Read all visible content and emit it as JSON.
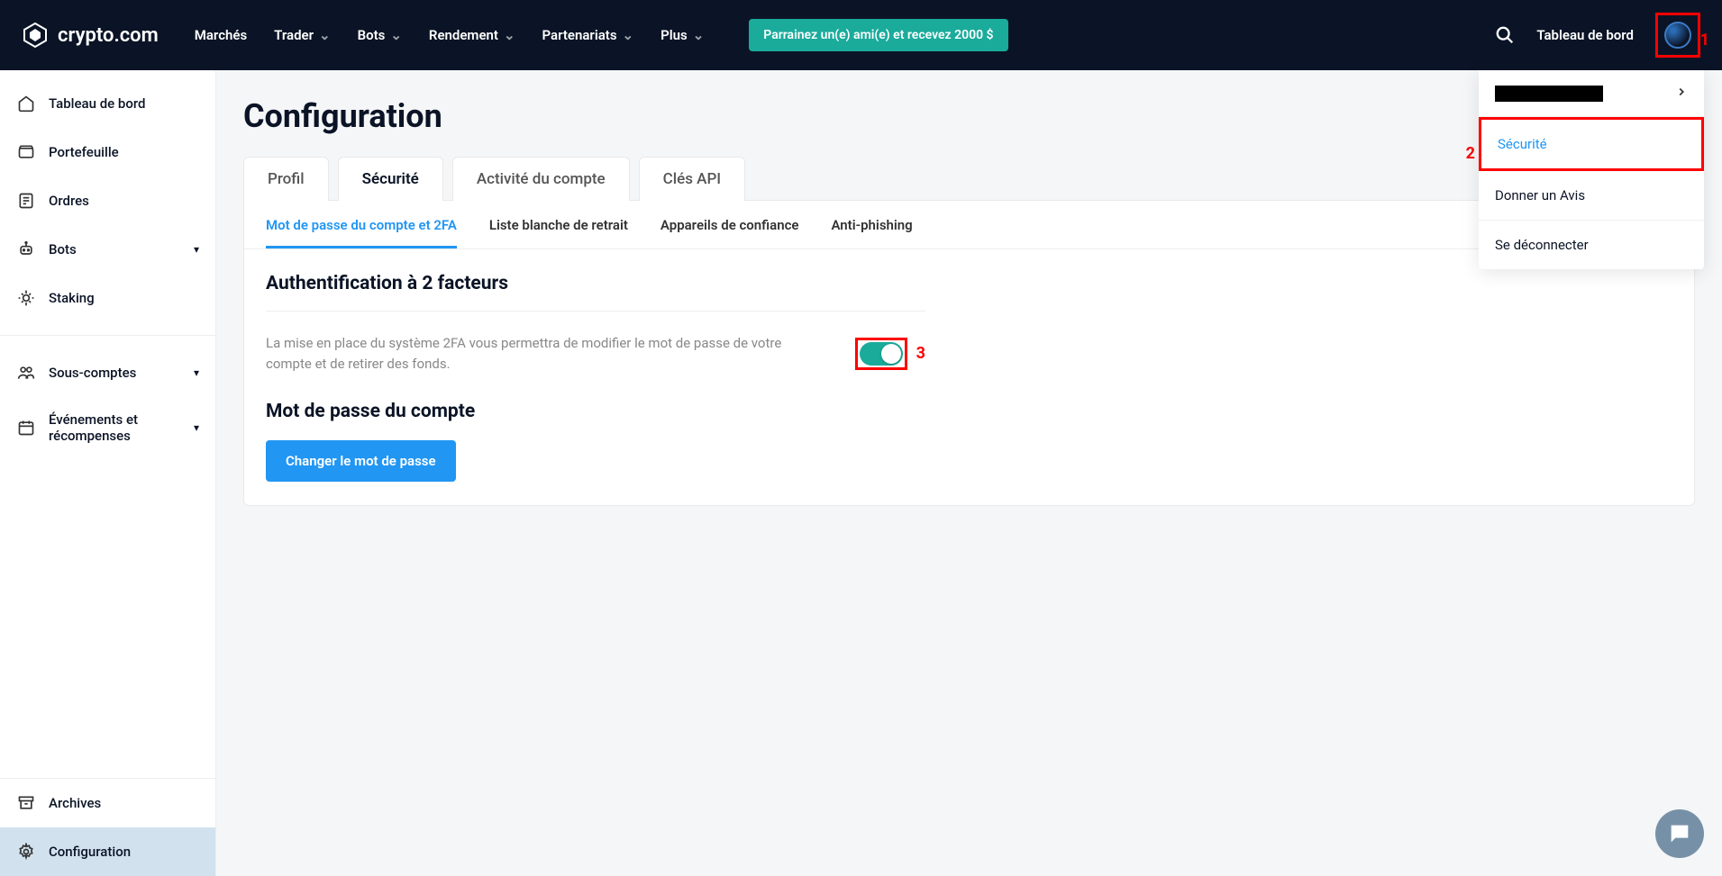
{
  "brand": "crypto.com",
  "nav": {
    "items": [
      {
        "label": "Marchés",
        "dropdown": false
      },
      {
        "label": "Trader",
        "dropdown": true
      },
      {
        "label": "Bots",
        "dropdown": true
      },
      {
        "label": "Rendement",
        "dropdown": true
      },
      {
        "label": "Partenariats",
        "dropdown": true
      },
      {
        "label": "Plus",
        "dropdown": true
      }
    ],
    "promo": "Parrainez un(e) ami(e) et recevez 2000 $",
    "dashboard": "Tableau de bord"
  },
  "sidebar": {
    "main": [
      {
        "label": "Tableau de bord",
        "icon": "home"
      },
      {
        "label": "Portefeuille",
        "icon": "wallet"
      },
      {
        "label": "Ordres",
        "icon": "orders"
      },
      {
        "label": "Bots",
        "icon": "bot",
        "expand": true
      },
      {
        "label": "Staking",
        "icon": "staking"
      }
    ],
    "secondary": [
      {
        "label": "Sous-comptes",
        "icon": "users",
        "expand": true
      },
      {
        "label": "Événements et récompenses",
        "icon": "calendar",
        "expand": true
      }
    ],
    "bottom": [
      {
        "label": "Archives",
        "icon": "archive"
      },
      {
        "label": "Configuration",
        "icon": "gear",
        "active": true
      }
    ]
  },
  "page": {
    "title": "Configuration",
    "tabs": [
      "Profil",
      "Sécurité",
      "Activité du compte",
      "Clés API"
    ],
    "activeTab": 1,
    "subtabs": [
      "Mot de passe du compte et 2FA",
      "Liste blanche de retrait",
      "Appareils de confiance",
      "Anti-phishing"
    ],
    "activeSubtab": 0,
    "twofa": {
      "title": "Authentification à 2 facteurs",
      "desc": "La mise en place du système 2FA vous permettra de modifier le mot de passe de votre compte et de retirer des fonds.",
      "enabled": true
    },
    "password": {
      "title": "Mot de passe du compte",
      "button": "Changer le mot de passe"
    }
  },
  "userMenu": {
    "items": [
      {
        "label": "Sécurité",
        "highlight": true
      },
      {
        "label": "Donner un Avis"
      },
      {
        "label": "Se déconnecter"
      }
    ]
  },
  "annotations": {
    "n1": "1",
    "n2": "2",
    "n3": "3"
  }
}
